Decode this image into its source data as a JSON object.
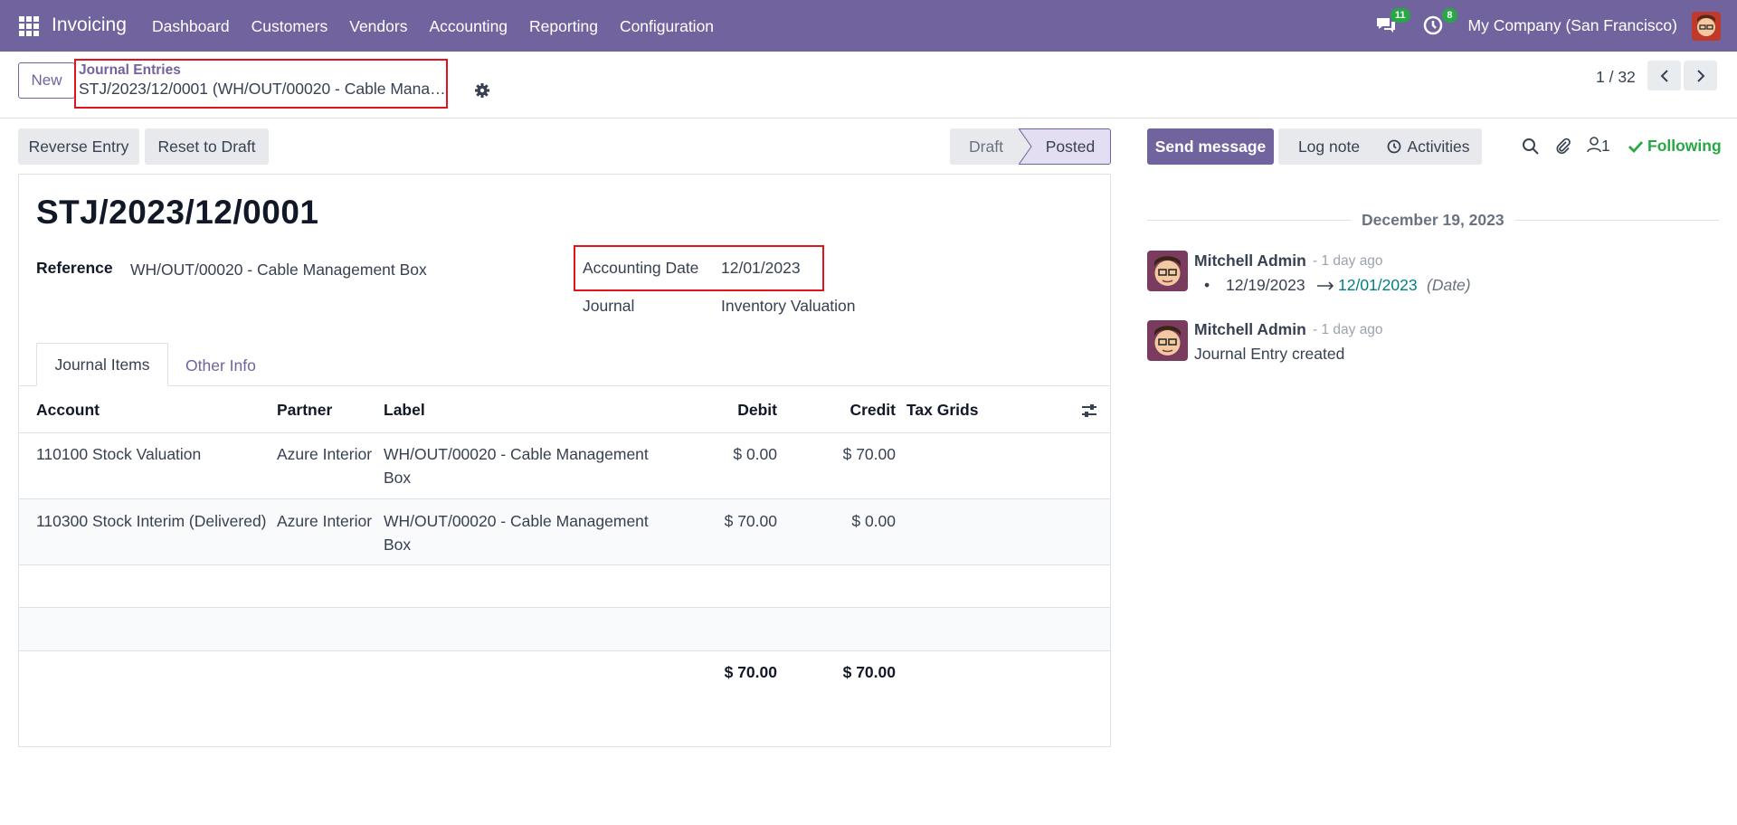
{
  "navbar": {
    "app_title": "Invoicing",
    "menu": [
      "Dashboard",
      "Customers",
      "Vendors",
      "Accounting",
      "Reporting",
      "Configuration"
    ],
    "messages_badge": "11",
    "activities_badge": "8",
    "company": "My Company (San Francisco)"
  },
  "control": {
    "new_label": "New",
    "breadcrumb_parent": "Journal Entries",
    "breadcrumb_current": "STJ/2023/12/0001 (WH/OUT/00020 - Cable Management Box)",
    "pager": "1 / 32"
  },
  "actions": {
    "reverse": "Reverse Entry",
    "reset": "Reset to Draft"
  },
  "statusbar": {
    "draft": "Draft",
    "posted": "Posted"
  },
  "form": {
    "name": "STJ/2023/12/0001",
    "reference_label": "Reference",
    "reference_value": "WH/OUT/00020 - Cable Management Box",
    "accounting_date_label": "Accounting Date",
    "accounting_date_value": "12/01/2023",
    "journal_label": "Journal",
    "journal_value": "Inventory Valuation"
  },
  "tabs": {
    "journal_items": "Journal Items",
    "other_info": "Other Info"
  },
  "table": {
    "headers": {
      "account": "Account",
      "partner": "Partner",
      "label": "Label",
      "debit": "Debit",
      "credit": "Credit",
      "tax_grids": "Tax Grids"
    },
    "rows": [
      {
        "account": "110100 Stock Valuation",
        "partner": "Azure Interior",
        "label_line1": "WH/OUT/00020 - Cable Management",
        "label_line2": "Box",
        "debit": "$ 0.00",
        "credit": "$ 70.00"
      },
      {
        "account": "110300 Stock Interim (Delivered)",
        "partner": "Azure Interior",
        "label_line1": "WH/OUT/00020 - Cable Management",
        "label_line2": "Box",
        "debit": "$ 70.00",
        "credit": "$ 0.00"
      }
    ],
    "total_debit": "$ 70.00",
    "total_credit": "$ 70.00"
  },
  "chatter": {
    "send_message": "Send message",
    "log_note": "Log note",
    "activities": "Activities",
    "followers_count": "1",
    "following": "Following",
    "date_separator": "December 19, 2023",
    "messages": [
      {
        "author": "Mitchell Admin",
        "ago": "- 1 day ago",
        "old_value": "12/19/2023",
        "new_value": "12/01/2023",
        "field": "(Date)"
      },
      {
        "author": "Mitchell Admin",
        "ago": "- 1 day ago",
        "body": "Journal Entry created"
      }
    ]
  },
  "colors": {
    "brand": "#71639e",
    "highlight_box": "#e0141e",
    "following": "#28a745",
    "link": "#017e84"
  }
}
